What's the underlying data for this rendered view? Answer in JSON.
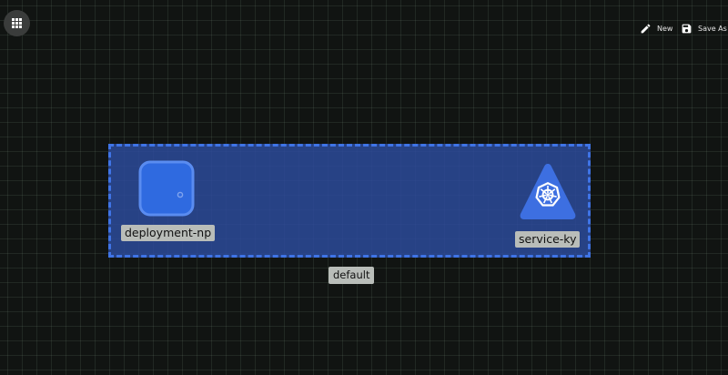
{
  "toolbar": {
    "new_label": "New",
    "save_as_label": "Save As"
  },
  "canvas": {
    "namespace": {
      "label": "default",
      "fill_color": "#2b4a9a",
      "border_color": "#3f74e6"
    },
    "nodes": [
      {
        "label": "deployment-np",
        "type": "deployment",
        "icon": "rounded-square-icon"
      },
      {
        "label": "service-ky",
        "type": "service",
        "icon": "kubernetes-service-icon"
      }
    ]
  },
  "icons": {
    "apps": "grid-icon",
    "new": "pencil-icon",
    "save_as": "floppy-disk-icon"
  },
  "colors": {
    "background": "#111412",
    "accent": "#3f74e6",
    "label_bg": "#b9bdb9"
  }
}
